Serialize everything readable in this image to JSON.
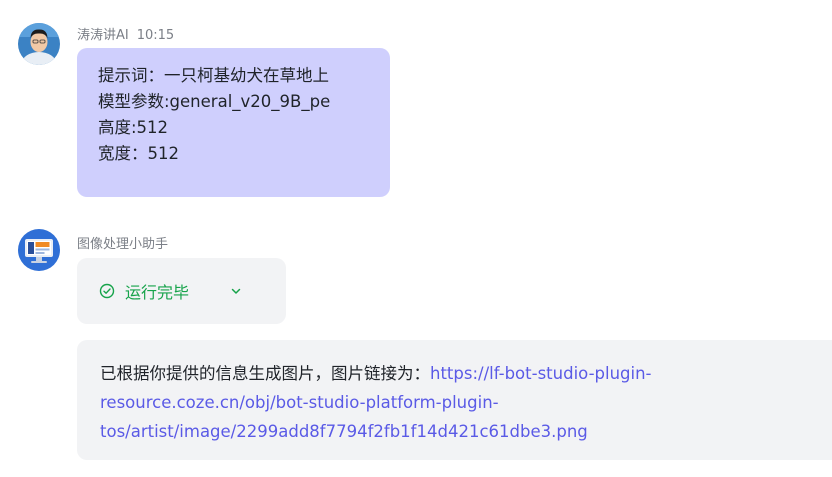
{
  "user_message": {
    "sender": "涛涛讲AI",
    "time": "10:15",
    "lines": [
      "提示词：一只柯基幼犬在草地上",
      "模型参数:general_v20_9B_pe",
      "高度:512",
      "宽度：512"
    ],
    "avatar_icon": "person-photo-avatar"
  },
  "bot_message": {
    "sender": "图像处理小助手",
    "status": "运行完毕",
    "status_icon": "check-circle-icon",
    "expand_icon": "chevron-down-icon",
    "answer_prefix": "已根据你提供的信息生成图片，图片链接为：",
    "answer_url_lines": [
      "https://lf-bot-studio-plugin-",
      "resource.coze.cn/obj/bot-studio-platform-plugin-",
      "tos/artist/image/2299add8f7794f2fb1f14d421c61dbe3.png"
    ],
    "avatar_icon": "monitor-avatar"
  },
  "colors": {
    "user_bubble": "#cfcffd",
    "card_bg": "#f2f3f5",
    "success": "#16a34a",
    "link": "#5a5ae6"
  }
}
